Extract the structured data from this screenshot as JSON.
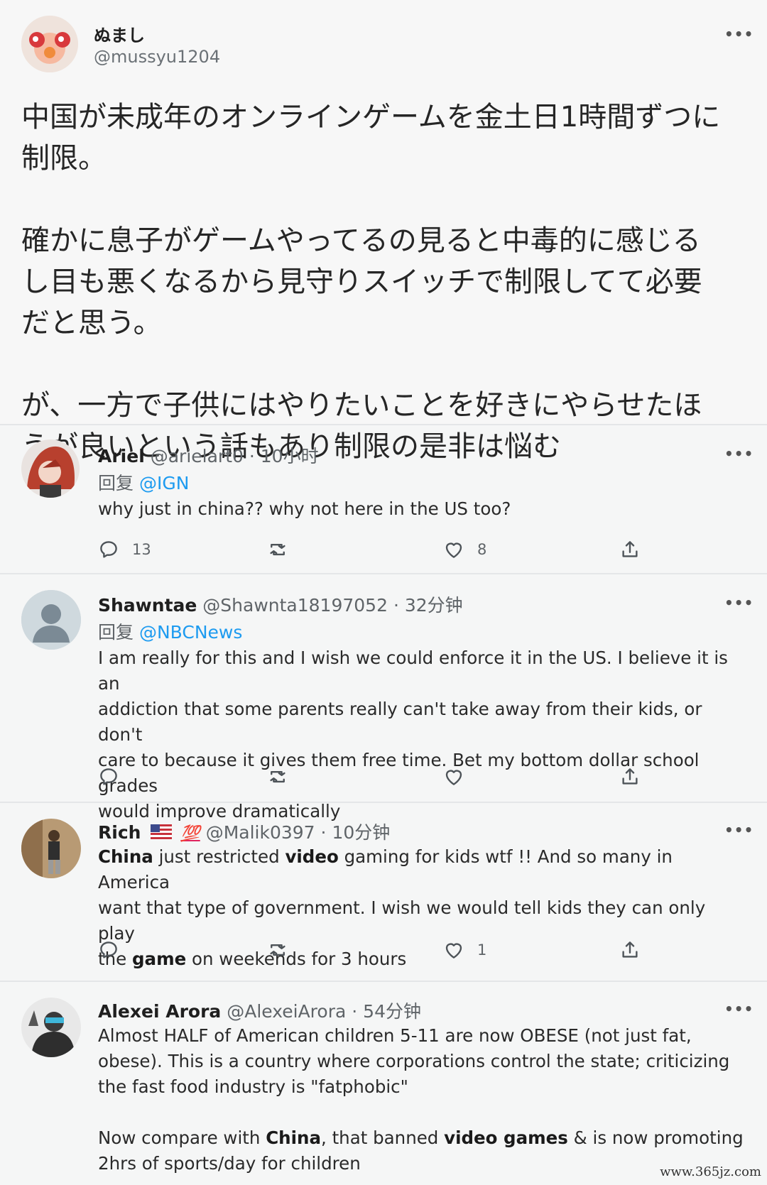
{
  "main": {
    "name": "ぬまし",
    "handle": "@mussyu1204",
    "text": "中国が未成年のオンラインゲームを金土日1時間ずつに\n制限。\n\n確かに息子がゲームやってるの見ると中毒的に感じる\nし目も悪くなるから見守りスイッチで制限してて必要\nだと思う。\n\nが、一方で子供にはやりたいことを好きにやらせたほ\nうが良いという話もあり制限の是非は悩む"
  },
  "replies": [
    {
      "name": "Ariel",
      "handle": "@arielart0",
      "time": "· 10小时",
      "reply_label": "回复",
      "reply_to": "@IGN",
      "text": "why just in china?? why not here in the US too?",
      "reply_count": "13",
      "retweet_count": "",
      "like_count": "8"
    },
    {
      "name": "Shawntae",
      "handle": "@Shawnta18197052",
      "time": "· 32分钟",
      "reply_label": "回复",
      "reply_to": "@NBCNews",
      "text": "I am really for this and I wish we could enforce it in the US. I believe it is an\naddiction that some parents really can't take away from their kids, or don't\ncare to because it gives them free time. Bet my bottom dollar school grades\nwould improve dramatically",
      "reply_count": "",
      "retweet_count": "",
      "like_count": ""
    },
    {
      "name": "Rich",
      "badge": "💯",
      "handle": "@Malik0397",
      "time": "· 10分钟",
      "segments": [
        {
          "t": "China",
          "b": true
        },
        {
          "t": " just restricted ",
          "b": false
        },
        {
          "t": "video",
          "b": true
        },
        {
          "t": " gaming for kids wtf !! And so many in America\nwant that type of government. I wish we would tell kids they can only play\nthe ",
          "b": false
        },
        {
          "t": "game",
          "b": true
        },
        {
          "t": " on weekends for 3 hours",
          "b": false
        }
      ],
      "reply_count": "",
      "retweet_count": "",
      "like_count": "1"
    },
    {
      "name": "Alexei Arora",
      "handle": "@AlexeiArora",
      "time": "· 54分钟",
      "segments": [
        {
          "t": "Almost HALF of American children 5-11 are now OBESE (not just fat,\nobese). This is a country where corporations control the state; criticizing\nthe fast food industry is \"fatphobic\"\n\nNow compare with ",
          "b": false
        },
        {
          "t": "China",
          "b": true
        },
        {
          "t": ", that banned ",
          "b": false
        },
        {
          "t": "video games",
          "b": true
        },
        {
          "t": " & is now promoting\n2hrs of sports/day for children",
          "b": false
        }
      ]
    }
  ],
  "more_label": "•••",
  "watermark": "www.365jz.com",
  "icons": {
    "reply": "reply-icon",
    "retweet": "retweet-icon",
    "like": "heart-icon",
    "share": "share-icon",
    "more": "more-icon"
  },
  "colors": {
    "mention": "#1d9bf0",
    "secondary_text": "#5f6468",
    "background": "#f5f6f6"
  }
}
